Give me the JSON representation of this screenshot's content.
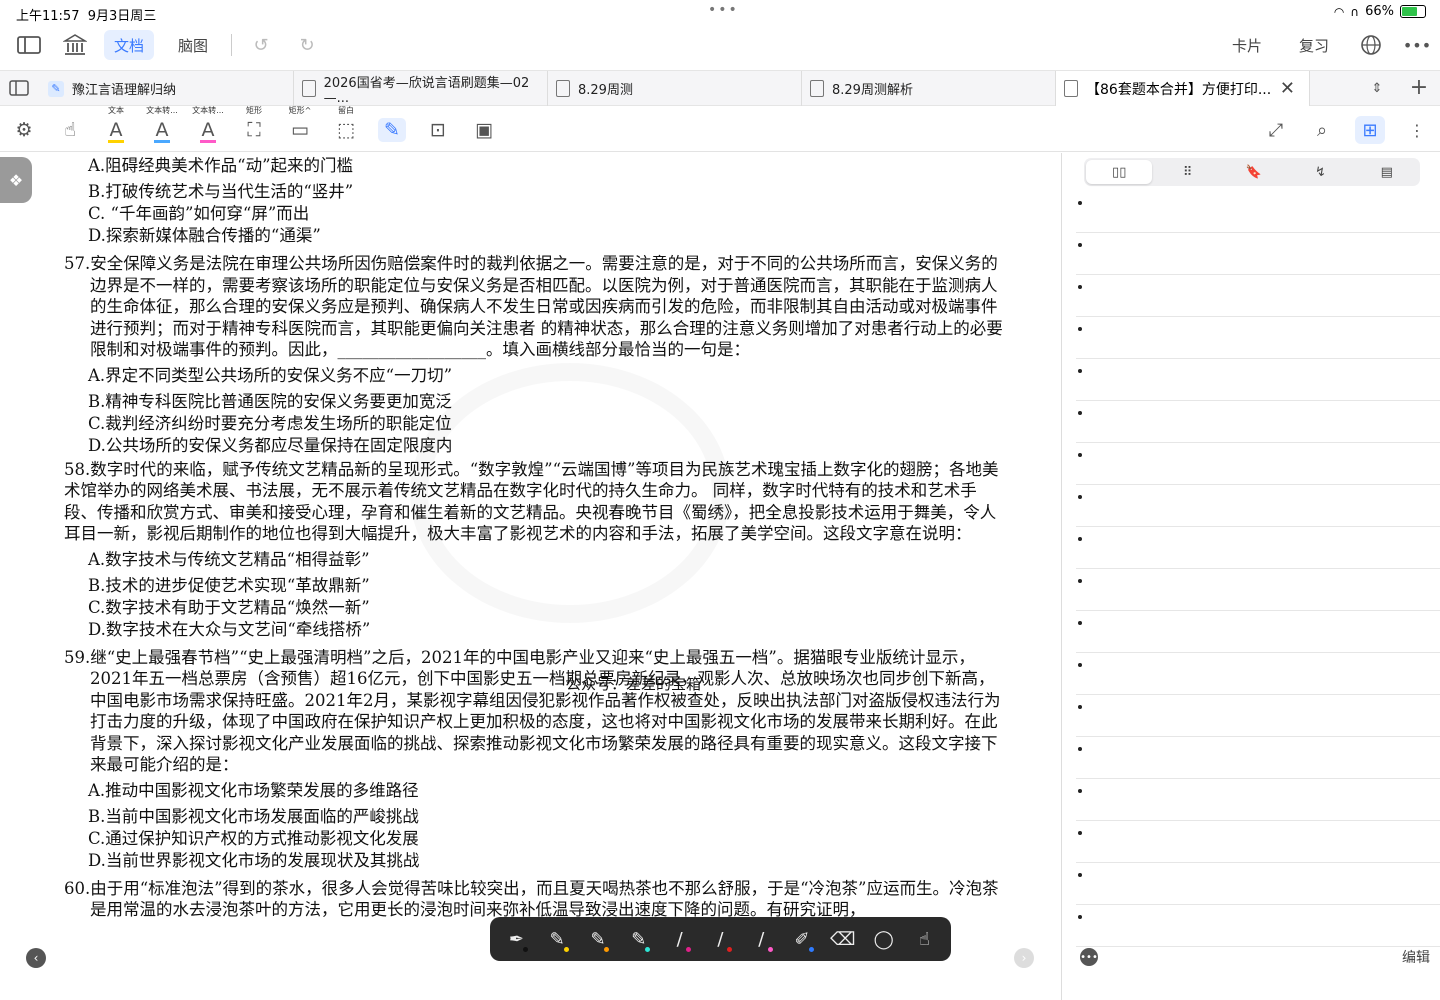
{
  "status": {
    "time": "上午11:57",
    "date": "9月3日周三",
    "battery": "66%"
  },
  "toolbar": {
    "doc_tab": "文档",
    "mind_tab": "脑图",
    "card": "卡片",
    "review": "复习"
  },
  "doc_tabs": [
    {
      "label": "豫江言语理解归纳"
    },
    {
      "label": "2026国省考—欣说言语刷题集—02—..."
    },
    {
      "label": "8.29周测"
    },
    {
      "label": "8.29周测解析"
    },
    {
      "label": "【86套题本合并】方便打印..."
    }
  ],
  "annot_tools": {
    "t1": "文本",
    "t2": "文本转...",
    "t3": "文本转...",
    "t4": "矩形",
    "t5": "矩形^",
    "t6": "留白"
  },
  "colors": {
    "accent": "#3b7bff",
    "highlight_yellow": "#ffd200",
    "highlight_blue": "#4aa8ff",
    "highlight_pink": "#ff5ac8"
  },
  "doc": {
    "q56_options": [
      "A.阻碍经典美术作品“动”起来的门槛",
      "B.打破传统艺术与当代生活的“竖井”",
      "C. “千年画韵”如何穿“屏”而出",
      "D.探索新媒体融合传播的“通渠”"
    ],
    "q57": "57.安全保障义务是法院在审理公共场所因伤赔偿案件时的裁判依据之一。需要注意的是，对于不同的公共场所而言，安保义务的边界是不一样的，需要考察该场所的职能定位与安保义务是否相匹配。以医院为例，对于普通医院而言，其职能在于监测病人的生命体征，那么合理的安保义务应是预判、确保病人不发生日常或因疾病而引发的危险，而非限制其自由活动或对极端事件进行预判；而对于精神专科医院而言，其职能更偏向关注患者 的精神状态，那么合理的注意义务则增加了对患者行动上的必要限制和对极端事件的预判。因此，__________________。填入画横线部分最恰当的一句是：",
    "q57_options": [
      "A.界定不同类型公共场所的安保义务不应“一刀切”",
      "B.精神专科医院比普通医院的安保义务要更加宽泛",
      "C.裁判经济纠纷时要充分考虑发生场所的职能定位",
      "D.公共场所的安保义务都应尽量保持在固定限度内"
    ],
    "q58": "58.数字时代的来临，赋予传统文艺精品新的呈现形式。“数字敦煌”“云端国博”等项目为民族艺术瑰宝插上数字化的翅膀；各地美术馆举办的网络美术展、书法展，无不展示着传统文艺精品在数字化时代的持久生命力。 同样，数字时代特有的技术和艺术手段、传播和欣赏方式、审美和接受心理，孕育和催生着新的文艺精品。央视春晚节目《蜀绣》，把全息投影技术运用于舞美，令人耳目一新，影视后期制作的地位也得到大幅提升，极大丰富了影视艺术的内容和手法，拓展了美学空间。这段文字意在说明：",
    "q58_options": [
      "A.数字技术与传统文艺精品“相得益彰”",
      "B.技术的进步促使艺术实现“革故鼎新”",
      "C.数字技术有助于文艺精品“焕然一新”",
      "D.数字技术在大众与文艺间“牵线搭桥”"
    ],
    "wechat": "公众号：差差的宝箱",
    "q59": "59.继“史上最强春节档”“史上最强清明档”之后，2021年的中国电影产业又迎来“史上最强五一档”。据猫眼专业版统计显示，2021年五一档总票房（含预售）超16亿元，创下中国影史五一档期总票房新纪录，观影人次、总放映场次也同步创下新高，中国电影市场需求保持旺盛。2021年2月，某影视字幕组因侵犯影视作品著作权被查处，反映出执法部门对盗版侵权违法行为打击力度的升级，体现了中国政府在保护知识产权上更加积极的态度，这也将对中国影视文化市场的发展带来长期利好。在此背景下，深入探讨影视文化产业发展面临的挑战、探索推动影视文化市场繁荣发展的路径具有重要的现实意义。这段文字接下来最可能介绍的是：",
    "q59_options": [
      "A.推动中国影视文化市场繁荣发展的多维路径",
      "B.当前中国影视文化市场发展面临的严峻挑战",
      "C.通过保护知识产权的方式推动影视文化发展",
      "D.当前世界影视文化市场的发展现状及其挑战"
    ],
    "q60": "60.由于用“标准泡法”得到的茶水，很多人会觉得苦味比较突出，而且夏天喝热茶也不那么舒服，于是“冷泡茶”应运而生。冷泡茶是用常温的水去浸泡茶叶的方法，它用更长的浸泡时间来弥补低温导致浸出速度下降的问题。有研究证明，"
  },
  "sidebar": {
    "edit": "编辑",
    "rows": 18
  }
}
